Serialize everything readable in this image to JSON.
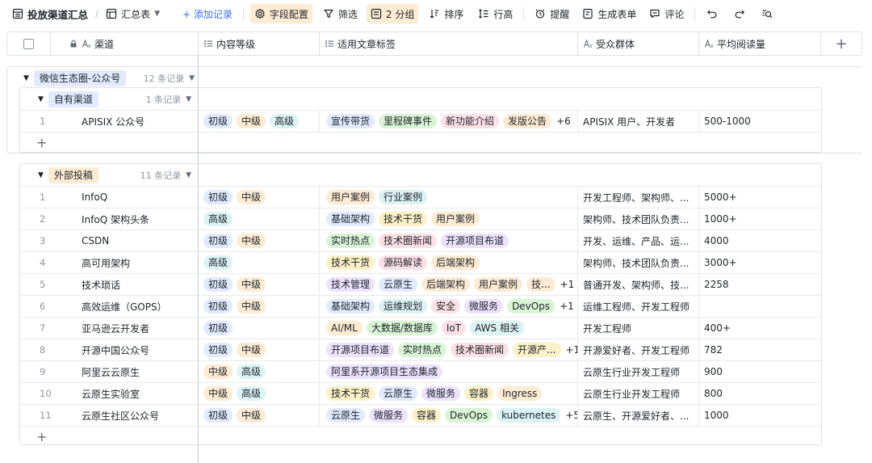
{
  "toolbar": {
    "title": "投放渠道汇总",
    "view": "汇总表",
    "add_record": "+ 添加记录",
    "field_config": "字段配置",
    "filter": "筛选",
    "group": "2 分组",
    "sort": "排序",
    "row_height": "行高",
    "remind": "提醒",
    "form": "生成表单",
    "comment": "评论"
  },
  "columns": [
    "渠道",
    "内容等级",
    "适用文章标签",
    "受众群体",
    "平均阅读量"
  ],
  "group1": {
    "label": "微信生态圈-公众号",
    "count": "12 条记录",
    "sub": {
      "label": "自有渠道",
      "count": "1 条记录",
      "rows": [
        {
          "idx": "1",
          "channel": "APISIX 公众号",
          "levels": [
            "初级",
            "中级",
            "高级"
          ],
          "tags": [
            "宣传带货",
            "里程碑事件",
            "新功能介绍",
            "发版公告"
          ],
          "more": "+6",
          "audience": "APISIX 用户、开发者",
          "reads": "500-1000"
        }
      ]
    }
  },
  "group2": {
    "label": "外部投稿",
    "count": "11 条记录",
    "rows": [
      {
        "idx": "1",
        "channel": "InfoQ",
        "levels": [
          "初级",
          "中级"
        ],
        "tags": [
          "用户案例",
          "行业案例"
        ],
        "more": "",
        "audience": "开发工程师、架构师、...",
        "reads": "5000+"
      },
      {
        "idx": "2",
        "channel": "InfoQ 架构头条",
        "levels": [
          "高级"
        ],
        "tags": [
          "基础架构",
          "技术干货",
          "用户案例"
        ],
        "more": "",
        "audience": "架构师、技术团队负责...",
        "reads": "1000+"
      },
      {
        "idx": "3",
        "channel": "CSDN",
        "levels": [
          "初级",
          "中级"
        ],
        "tags": [
          "实时热点",
          "技术圈新闻",
          "开源项目布道"
        ],
        "more": "",
        "audience": "开发、运维、产品、运...",
        "reads": "4000"
      },
      {
        "idx": "4",
        "channel": "高可用架构",
        "levels": [
          "高级"
        ],
        "tags": [
          "技术干货",
          "源码解读",
          "后端架构"
        ],
        "more": "",
        "audience": "架构师、技术团队负责...",
        "reads": "3000+"
      },
      {
        "idx": "5",
        "channel": "技术琐话",
        "levels": [
          "初级",
          "中级"
        ],
        "tags": [
          "技术管理",
          "云原生",
          "后端架构",
          "用户案例",
          "技..."
        ],
        "more": "+1",
        "audience": "普通开发、架构师、技...",
        "reads": "2258"
      },
      {
        "idx": "6",
        "channel": "高效运维（GOPS）",
        "levels": [
          "初级",
          "中级"
        ],
        "tags": [
          "基础架构",
          "运维规划",
          "安全",
          "微服务",
          "DevOps"
        ],
        "more": "+1",
        "audience": "运维工程师、开发工程师",
        "reads": ""
      },
      {
        "idx": "7",
        "channel": "亚马逊云开发者",
        "levels": [
          "初级"
        ],
        "tags": [
          "AI/ML",
          "大数据/数据库",
          "IoT",
          "AWS 相关"
        ],
        "more": "",
        "audience": "开发工程师",
        "reads": "400+"
      },
      {
        "idx": "8",
        "channel": "开源中国公众号",
        "levels": [
          "初级",
          "中级"
        ],
        "tags": [
          "开源项目布道",
          "实时热点",
          "技术圈新闻",
          "开源产..."
        ],
        "more": "+1",
        "audience": "开源爱好者、开发工程师",
        "reads": "782"
      },
      {
        "idx": "9",
        "channel": "阿里云云原生",
        "levels": [
          "中级",
          "高级"
        ],
        "tags": [
          "阿里系开源项目生态集成"
        ],
        "more": "",
        "audience": "云原生行业开发工程师",
        "reads": "900"
      },
      {
        "idx": "10",
        "channel": "云原生实验室",
        "levels": [
          "中级",
          "高级"
        ],
        "tags": [
          "技术干货",
          "云原生",
          "微服务",
          "容器",
          "Ingress"
        ],
        "more": "",
        "audience": "云原生行业开发工程师",
        "reads": "800"
      },
      {
        "idx": "11",
        "channel": "云原生社区公众号",
        "levels": [
          "初级",
          "中级"
        ],
        "tags": [
          "云原生",
          "微服务",
          "容器",
          "DevOps",
          "kubernetes"
        ],
        "more": "+5",
        "audience": "云原生、开源爱好者、...",
        "reads": "1000"
      }
    ]
  },
  "colors": {
    "level": {
      "初级": "#e1eaff",
      "中级": "#fdebd3",
      "高级": "#dbf3f5"
    },
    "tag": {
      "宣传带货": "#e1eaff",
      "里程碑事件": "#d9f5d6",
      "新功能介绍": "#fbe1e6",
      "发版公告": "#fdebd3",
      "用户案例": "#fdebd3",
      "行业案例": "#dbf3f5",
      "基础架构": "#e1eaff",
      "技术干货": "#faf1c7",
      "实时热点": "#d9f5d6",
      "技术圈新闻": "#fbe1e6",
      "开源项目布道": "#ece2fe",
      "源码解读": "#fbe1e6",
      "后端架构": "#fdebd3",
      "技术管理": "#ece2fe",
      "云原生": "#e1eaff",
      "技...": "#fdebd3",
      "运维规划": "#dbf3f5",
      "安全": "#fbe1e6",
      "微服务": "#ece2fe",
      "DevOps": "#d9f5d6",
      "AI/ML": "#fdebd3",
      "大数据/数据库": "#d9f5d6",
      "IoT": "#fbe1e6",
      "AWS 相关": "#dbf3f5",
      "开源产...": "#faf1c7",
      "阿里系开源项目生态集成": "#ece2fe",
      "容器": "#faf1c7",
      "Ingress": "#fdebd3",
      "kubernetes": "#dbf3f5"
    },
    "group_tag": "#e1eaff",
    "sub_tag_own": "#e1eaff",
    "sub_tag_ext": "#fdebd3"
  }
}
